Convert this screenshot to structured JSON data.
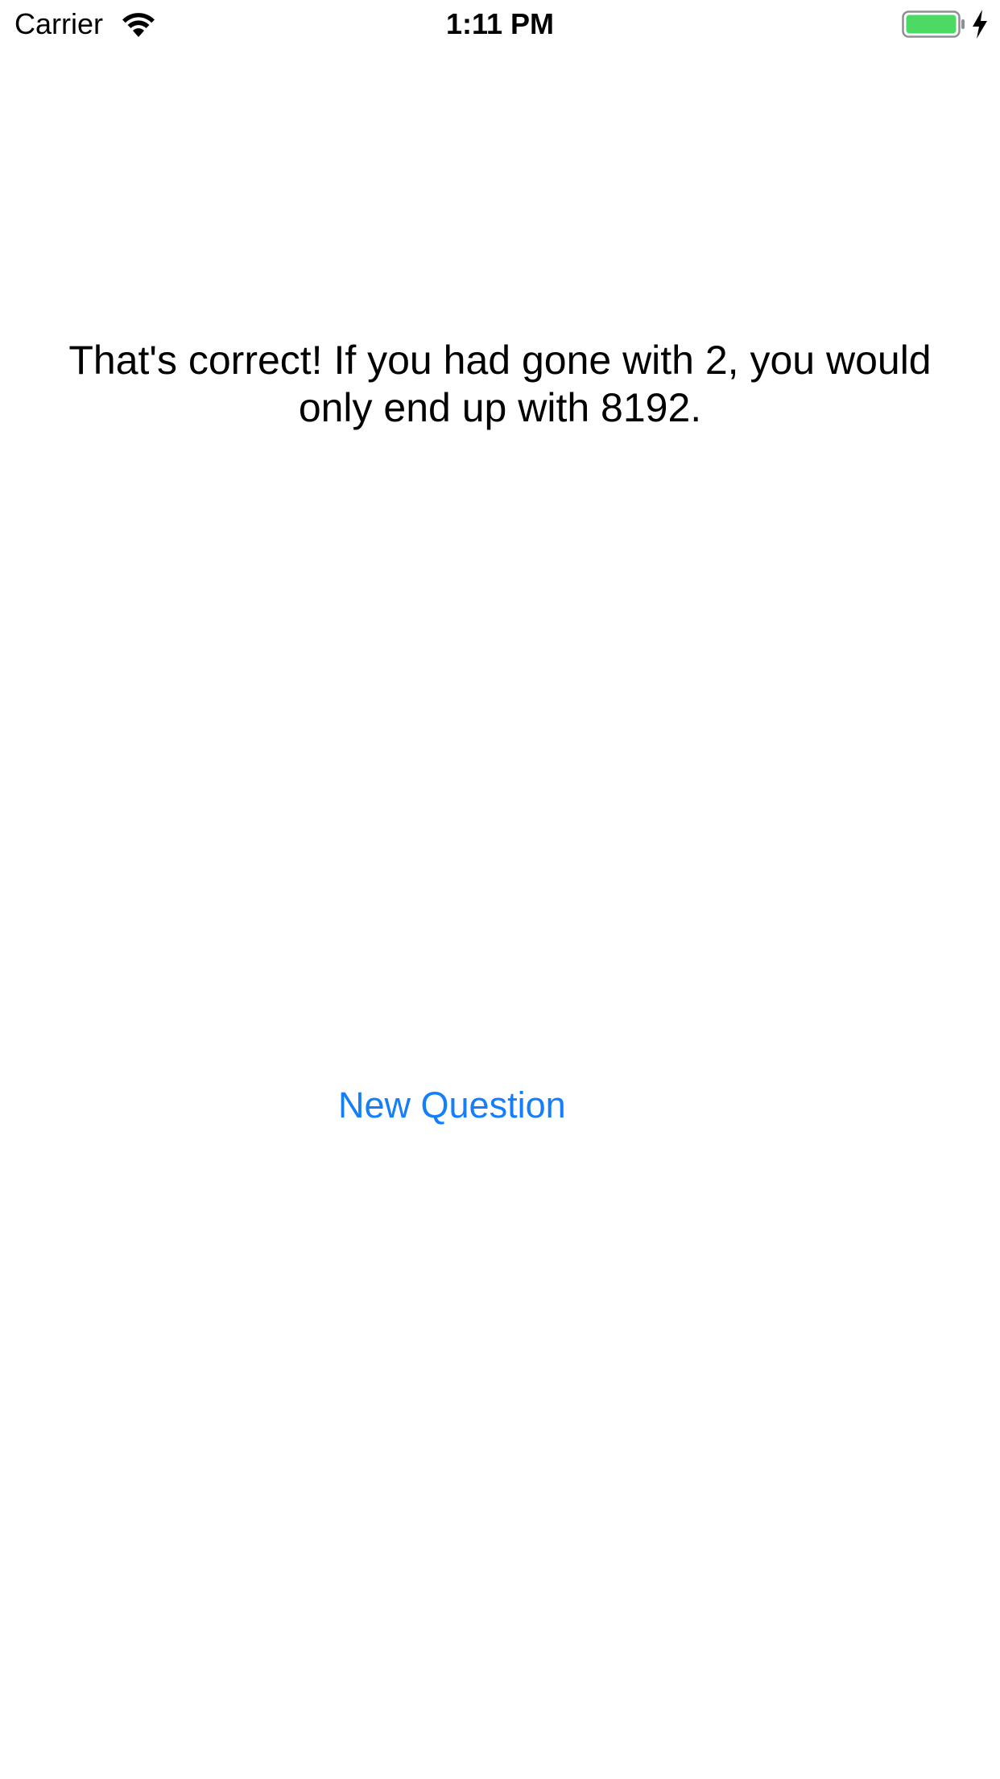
{
  "status_bar": {
    "carrier": "Carrier",
    "time": "1:11 PM",
    "wifi_icon": "wifi-icon",
    "battery_icon": "battery-icon",
    "charging_icon": "bolt-icon",
    "battery_level": 1.0,
    "battery_color": "#4cd964"
  },
  "main": {
    "message": "That's correct! If you had gone with 2, you would only end up with 8192.",
    "new_question_label": "New Question",
    "accent_color": "#147efb"
  }
}
